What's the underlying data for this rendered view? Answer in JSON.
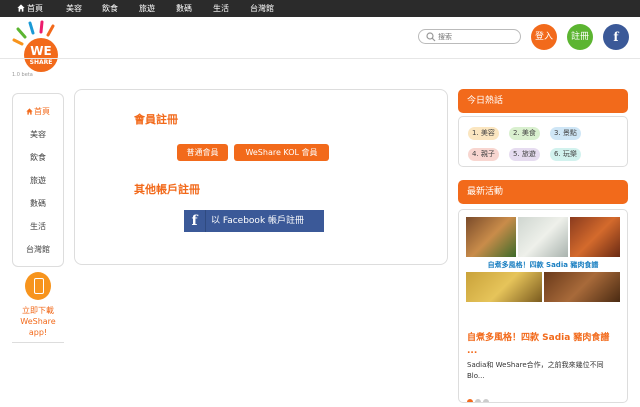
{
  "topnav": {
    "items": [
      "首頁",
      "美容",
      "飲食",
      "旅遊",
      "數碼",
      "生活",
      "台灣館"
    ]
  },
  "logo": {
    "text": "WE SHARE",
    "version": "1.0 beta"
  },
  "search": {
    "placeholder": "搜索"
  },
  "header_buttons": {
    "login": "登入",
    "register": "註冊",
    "facebook": "f"
  },
  "sidebar": {
    "items": [
      "首頁",
      "美容",
      "飲食",
      "旅遊",
      "數碼",
      "生活",
      "台灣館"
    ],
    "active_index": 0
  },
  "app_download": {
    "line1": "立即下載",
    "line2": "WeShare",
    "line3": "app!"
  },
  "main": {
    "member_title": "會員註冊",
    "normal_member": "普通會員",
    "kol_member": "WeShare KOL 會員",
    "other_title": "其他帳戶註冊",
    "facebook_button": "以 Facebook 帳戶註冊",
    "facebook_icon": "f"
  },
  "hot_today": {
    "title": "今日熱話",
    "tags": [
      {
        "label": "1. 美容",
        "color": "#fbe6c0"
      },
      {
        "label": "2. 美食",
        "color": "#d9f0cf"
      },
      {
        "label": "3. 景點",
        "color": "#cfe6f6"
      },
      {
        "label": "4. 親子",
        "color": "#f8d6d0"
      },
      {
        "label": "5. 旅遊",
        "color": "#e6dcf0"
      },
      {
        "label": "6. 玩樂",
        "color": "#d2f2ee"
      }
    ]
  },
  "events": {
    "title": "最新活動",
    "photo_caption": "自煮多風格！四款 Sadia 豬肉食譜",
    "event_title": "自煮多風格！四款 Sadia 豬肉食譜 ...",
    "event_desc": "Sadia和 WeShare合作，之前我來幾位不同Blo...",
    "dots": 3,
    "active_dot": 0
  },
  "colors": {
    "accent": "#f26a1b",
    "green": "#5cb531",
    "facebook": "#3b5998",
    "topbar": "#2b2b2b"
  }
}
